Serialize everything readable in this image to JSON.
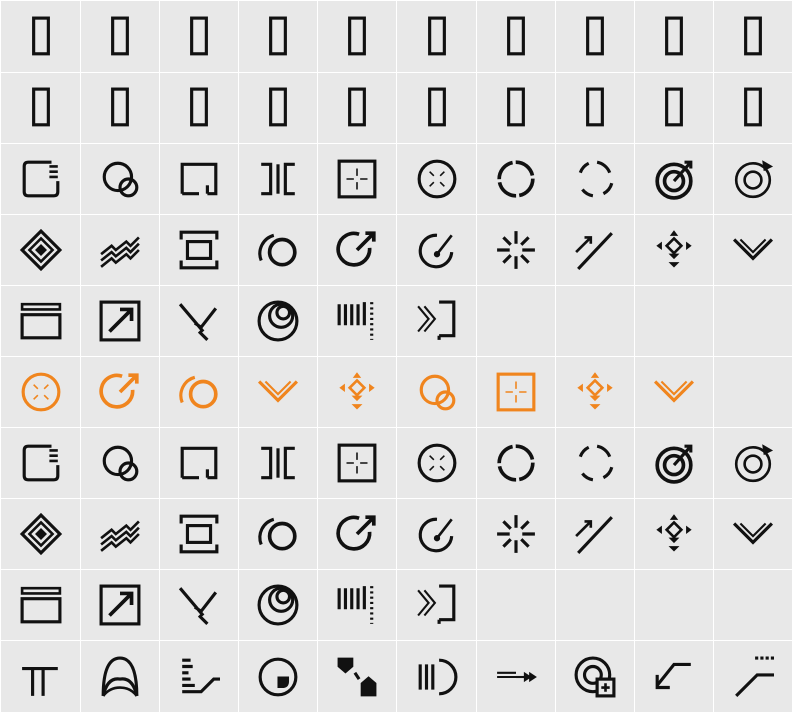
{
  "colors": {
    "background": "#e8e8e8",
    "gridline": "#ffffff",
    "ink": "#111111",
    "accent": "#f0851e"
  },
  "grid": {
    "rows": [
      {
        "color": "ink",
        "cells": [
          "box",
          "box",
          "box",
          "box",
          "box",
          "box",
          "box",
          "box",
          "box",
          "box"
        ]
      },
      {
        "color": "ink",
        "cells": [
          "box",
          "box",
          "box",
          "box",
          "box",
          "box",
          "box",
          "box",
          "box",
          "box"
        ]
      },
      {
        "color": "ink",
        "cells": [
          "tab-box",
          "circle-link",
          "bracket-frame",
          "split-bracket",
          "crosshair-square",
          "x-circle",
          "dashed-ring",
          "broken-ring",
          "target-arrow",
          "dot-ring-arrow"
        ]
      },
      {
        "color": "ink",
        "cells": [
          "nested-diamond",
          "zigzag-lines",
          "bracket-screen",
          "arc-circle",
          "circle-arrow",
          "dial-arrow",
          "burst",
          "double-arrow-line",
          "dpad-arrows",
          "double-chevron"
        ]
      },
      {
        "color": "ink",
        "cells": [
          "window-panel",
          "box-arrow",
          "check-cross",
          "spiral-rings",
          "barcode-dots",
          "chevrons-bracket",
          "",
          "",
          "",
          ""
        ]
      },
      {
        "color": "accent",
        "cells": [
          "x-circle",
          "circle-arrow",
          "arc-circle",
          "double-chevron",
          "dpad-arrows",
          "circle-link",
          "crosshair-square",
          "dpad-arrows",
          "double-chevron",
          ""
        ]
      },
      {
        "color": "ink",
        "cells": [
          "tab-box",
          "circle-link",
          "bracket-frame",
          "split-bracket",
          "crosshair-square",
          "x-circle",
          "dashed-ring",
          "broken-ring",
          "target-arrow",
          "dot-ring-arrow"
        ]
      },
      {
        "color": "ink",
        "cells": [
          "nested-diamond",
          "zigzag-lines",
          "bracket-screen",
          "arc-circle",
          "circle-arrow",
          "dial-arrow",
          "burst",
          "double-arrow-line",
          "dpad-arrows",
          "double-chevron"
        ]
      },
      {
        "color": "ink",
        "cells": [
          "window-panel",
          "box-arrow",
          "check-cross",
          "spiral-rings",
          "barcode-dots",
          "chevrons-bracket",
          "",
          "",
          "",
          ""
        ]
      },
      {
        "color": "ink",
        "cells": [
          "tee-step",
          "double-arch",
          "ladder-ramp",
          "circle-pointer",
          "shapes-pair",
          "bars-arc",
          "arrow-lines",
          "ring-plus-square",
          "corner-arrow",
          "dotted-ramp"
        ]
      }
    ]
  }
}
